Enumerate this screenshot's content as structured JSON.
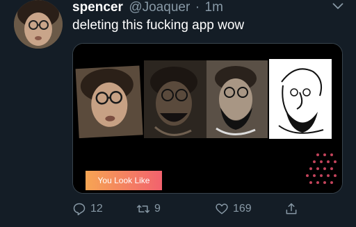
{
  "tweet": {
    "display_name": "spencer",
    "handle": "@Joaquer",
    "separator": "·",
    "time": "1m",
    "text": "deleting this fucking app wow",
    "media": {
      "badge_label": "You Look Like"
    },
    "actions": {
      "reply_count": "12",
      "retweet_count": "9",
      "like_count": "169"
    }
  },
  "icons": {
    "caret": "chevron-down-icon",
    "reply": "reply-icon",
    "retweet": "retweet-icon",
    "like": "heart-icon",
    "share": "share-icon"
  },
  "colors": {
    "background": "#141d26",
    "secondary_text": "#8899a6",
    "card_border": "#38444d",
    "badge_start": "#f6a553",
    "badge_end": "#f2626e"
  }
}
